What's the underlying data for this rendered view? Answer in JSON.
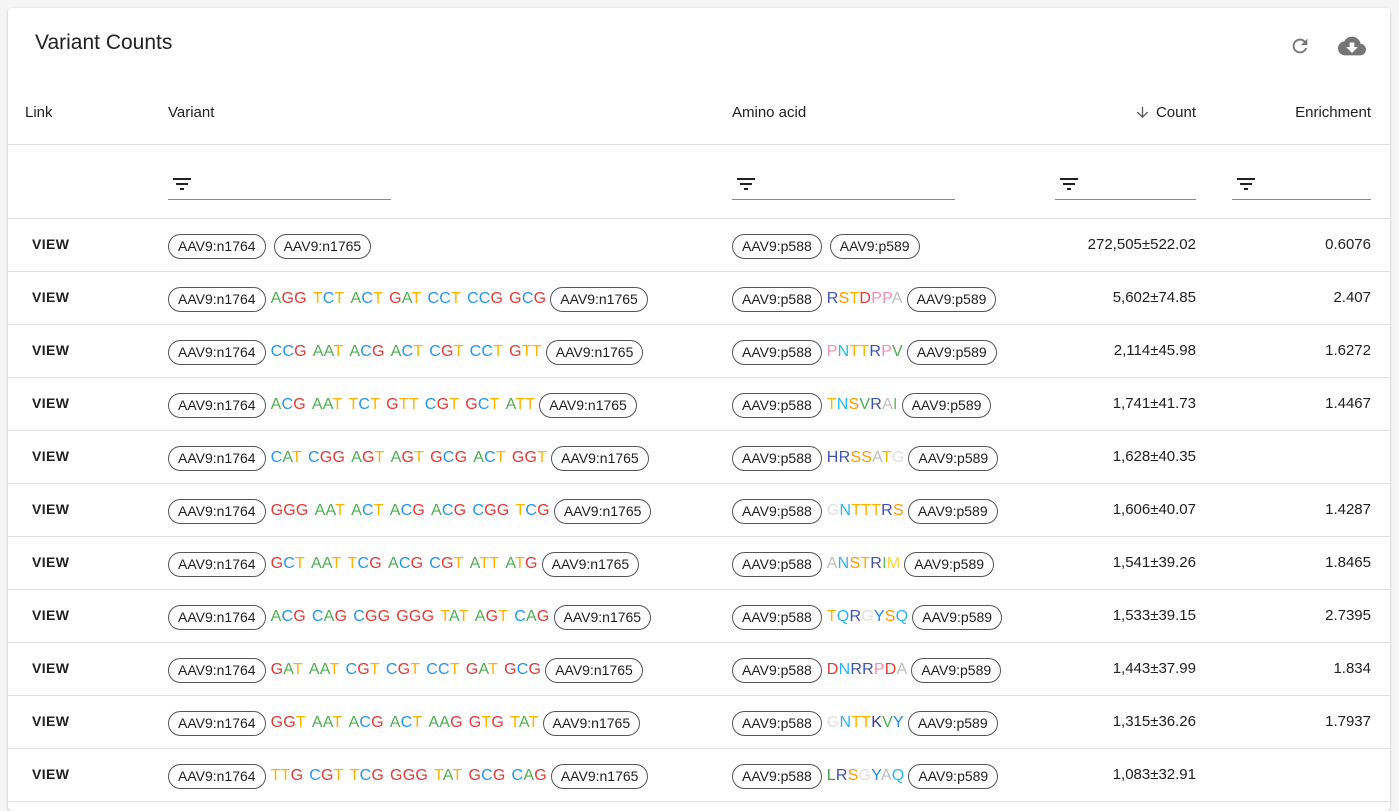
{
  "title": "Variant Counts",
  "toolbar": {
    "refresh_icon": "refresh-icon",
    "download_icon": "cloud-download-icon"
  },
  "columns": {
    "link": "Link",
    "variant": "Variant",
    "amino_acid": "Amino acid",
    "count": "Count",
    "enrichment": "Enrichment"
  },
  "view_label": "VIEW",
  "aa_colors": {
    "R": "#3f51b5",
    "S": "#ff9800",
    "T": "#ffb300",
    "D": "#e53935",
    "P": "#f48fb1",
    "A": "#bdbdbd",
    "N": "#29b6f6",
    "V": "#4caf50",
    "I": "#66bb6a",
    "H": "#3f51b5",
    "G": "#e0e0e0",
    "M": "#fdd835",
    "Q": "#29b6f6",
    "Y": "#1e88e5",
    "C": "#fbc02d",
    "K": "#303f9f",
    "L": "#43a047"
  },
  "rows": [
    {
      "left_chip": "AAV9:n1764",
      "right_chip": "AAV9:n1765",
      "codons": [],
      "aa_left": "AAV9:p588",
      "aa_right": "AAV9:p589",
      "aa": "",
      "count": "272,505±522.02",
      "enrichment": "0.6076"
    },
    {
      "left_chip": "AAV9:n1764",
      "right_chip": "AAV9:n1765",
      "codons": [
        "AGG",
        "TCT",
        "ACT",
        "GAT",
        "CCT",
        "CCG",
        "GCG"
      ],
      "aa_left": "AAV9:p588",
      "aa_right": "AAV9:p589",
      "aa": "RSTDPPA",
      "count": "5,602±74.85",
      "enrichment": "2.407"
    },
    {
      "left_chip": "AAV9:n1764",
      "right_chip": "AAV9:n1765",
      "codons": [
        "CCG",
        "AAT",
        "ACG",
        "ACT",
        "CGT",
        "CCT",
        "GTT"
      ],
      "aa_left": "AAV9:p588",
      "aa_right": "AAV9:p589",
      "aa": "PNTTRPV",
      "count": "2,114±45.98",
      "enrichment": "1.6272"
    },
    {
      "left_chip": "AAV9:n1764",
      "right_chip": "AAV9:n1765",
      "codons": [
        "ACG",
        "AAT",
        "TCT",
        "GTT",
        "CGT",
        "GCT",
        "ATT"
      ],
      "aa_left": "AAV9:p588",
      "aa_right": "AAV9:p589",
      "aa": "TNSVRAI",
      "count": "1,741±41.73",
      "enrichment": "1.4467"
    },
    {
      "left_chip": "AAV9:n1764",
      "right_chip": "AAV9:n1765",
      "codons": [
        "CAT",
        "CGG",
        "AGT",
        "AGT",
        "GCG",
        "ACT",
        "GGT"
      ],
      "aa_left": "AAV9:p588",
      "aa_right": "AAV9:p589",
      "aa": "HRSSATG",
      "count": "1,628±40.35",
      "enrichment": ""
    },
    {
      "left_chip": "AAV9:n1764",
      "right_chip": "AAV9:n1765",
      "codons": [
        "GGG",
        "AAT",
        "ACT",
        "ACG",
        "ACG",
        "CGG",
        "TCG"
      ],
      "aa_left": "AAV9:p588",
      "aa_right": "AAV9:p589",
      "aa": "GNTTTRS",
      "count": "1,606±40.07",
      "enrichment": "1.4287"
    },
    {
      "left_chip": "AAV9:n1764",
      "right_chip": "AAV9:n1765",
      "codons": [
        "GCT",
        "AAT",
        "TCG",
        "ACG",
        "CGT",
        "ATT",
        "ATG"
      ],
      "aa_left": "AAV9:p588",
      "aa_right": "AAV9:p589",
      "aa": "ANSTRIM",
      "count": "1,541±39.26",
      "enrichment": "1.8465"
    },
    {
      "left_chip": "AAV9:n1764",
      "right_chip": "AAV9:n1765",
      "codons": [
        "ACG",
        "CAG",
        "CGG",
        "GGG",
        "TAT",
        "AGT",
        "CAG"
      ],
      "aa_left": "AAV9:p588",
      "aa_right": "AAV9:p589",
      "aa": "TQRGYSQ",
      "count": "1,533±39.15",
      "enrichment": "2.7395"
    },
    {
      "left_chip": "AAV9:n1764",
      "right_chip": "AAV9:n1765",
      "codons": [
        "GAT",
        "AAT",
        "CGT",
        "CGT",
        "CCT",
        "GAT",
        "GCG"
      ],
      "aa_left": "AAV9:p588",
      "aa_right": "AAV9:p589",
      "aa": "DNRRPDA",
      "count": "1,443±37.99",
      "enrichment": "1.834"
    },
    {
      "left_chip": "AAV9:n1764",
      "right_chip": "AAV9:n1765",
      "codons": [
        "GGT",
        "AAT",
        "ACG",
        "ACT",
        "AAG",
        "GTG",
        "TAT"
      ],
      "aa_left": "AAV9:p588",
      "aa_right": "AAV9:p589",
      "aa": "GNTTKVY",
      "count": "1,315±36.26",
      "enrichment": "1.7937"
    },
    {
      "left_chip": "AAV9:n1764",
      "right_chip": "AAV9:n1765",
      "codons": [
        "TTG",
        "CGT",
        "TCG",
        "GGG",
        "TAT",
        "GCG",
        "CAG"
      ],
      "aa_left": "AAV9:p588",
      "aa_right": "AAV9:p589",
      "aa": "LRSGYAQ",
      "count": "1,083±32.91",
      "enrichment": ""
    }
  ]
}
